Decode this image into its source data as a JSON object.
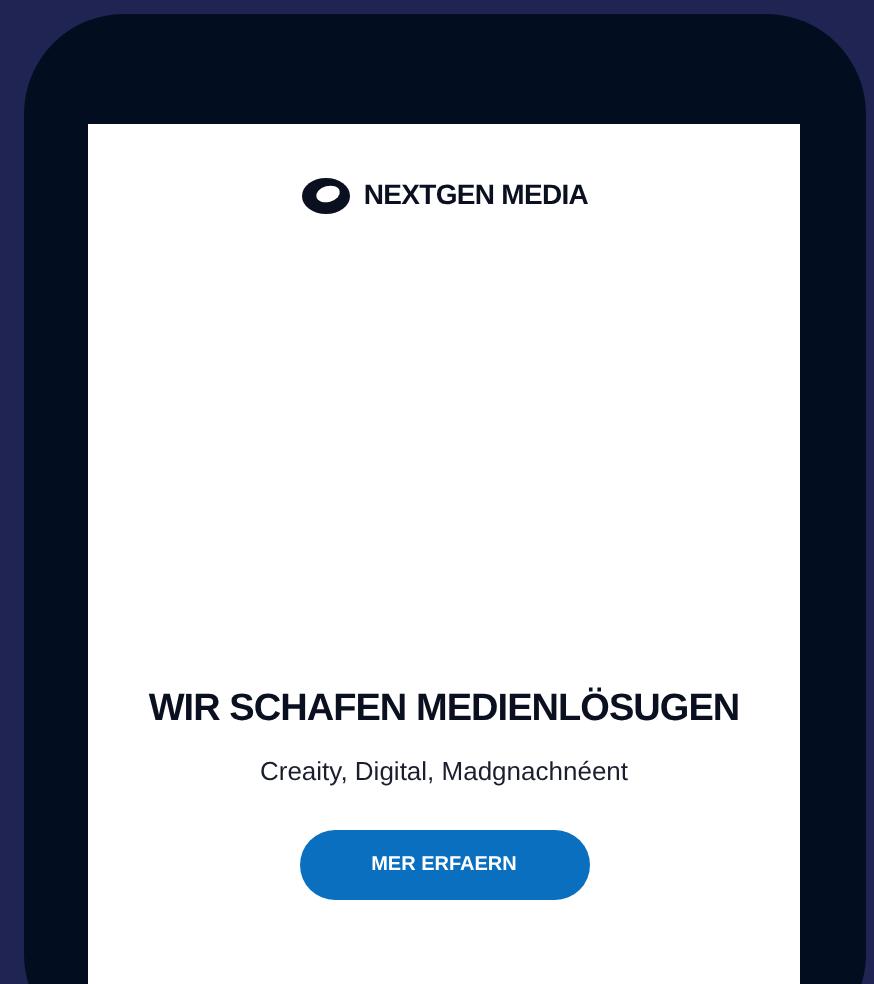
{
  "header": {
    "brand": "NEXTGEN MEDIA"
  },
  "hero": {
    "title": "WIR SCHAFEN MEDIENLÖSUGEN",
    "subtitle": "Creaity, Digital, Madgnachnéent",
    "button": "MER ERFAERN"
  }
}
